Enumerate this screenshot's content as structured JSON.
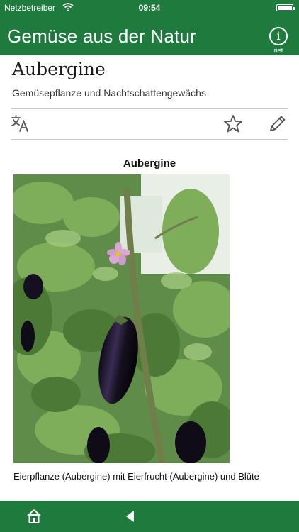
{
  "status_bar": {
    "carrier": "Netzbetreiber",
    "time": "09:54"
  },
  "nav": {
    "title": "Gemüse aus der Natur",
    "info_sub": "net"
  },
  "article": {
    "title": "Aubergine",
    "description": "Gemüsepflanze und Nachtschattengewächs"
  },
  "toolbar": {
    "translate_icon": "translate-icon",
    "star_icon": "star-icon",
    "edit_icon": "pencil-icon"
  },
  "figure": {
    "heading": "Aubergine",
    "caption": "Eierpflanze (Aubergine) mit Eierfrucht (Aubergine) und Blüte"
  },
  "bottom_bar": {
    "home_icon": "home-icon",
    "back_icon": "back-arrow-icon"
  },
  "colors": {
    "accent": "#1e7a3d",
    "divider": "#c8c8c8"
  }
}
